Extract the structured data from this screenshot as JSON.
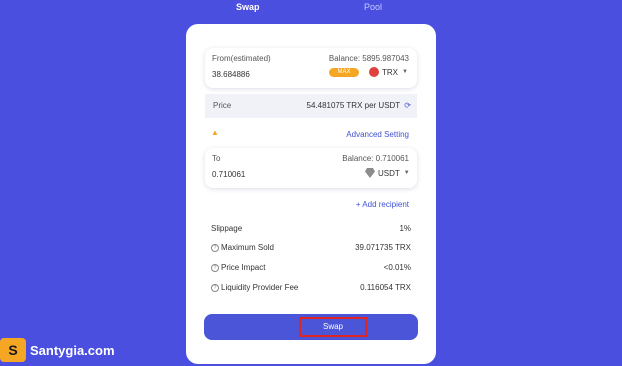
{
  "tabs": {
    "swap": "Swap",
    "pool": "Pool"
  },
  "from": {
    "label": "From(estimated)",
    "balance": "Balance: 5895.987043",
    "amount": "38.684886",
    "max": "MAX",
    "token": "TRX"
  },
  "price": {
    "label": "Price",
    "value": "54.481075 TRX per USDT"
  },
  "advanced_setting": "Advanced Setting",
  "to": {
    "label": "To",
    "balance": "Balance: 0.710061",
    "amount": "0.710061",
    "token": "USDT"
  },
  "add_recipient": "+ Add recipient",
  "details": {
    "slippage_label": "Slippage",
    "slippage_value": "1%",
    "max_sold_label": "Maximum Sold",
    "max_sold_value": "39.071735 TRX",
    "price_impact_label": "Price Impact",
    "price_impact_value": "<0.01%",
    "lp_fee_label": "Liquidity Provider Fee",
    "lp_fee_value": "0.116054 TRX"
  },
  "swap_button": "Swap",
  "watermark": {
    "logo": "S",
    "text": "Santygia.com"
  },
  "colors": {
    "background": "#4a4fe0",
    "accent": "#4a55d8",
    "highlight": "#e02424",
    "max_badge": "#f5a623"
  }
}
